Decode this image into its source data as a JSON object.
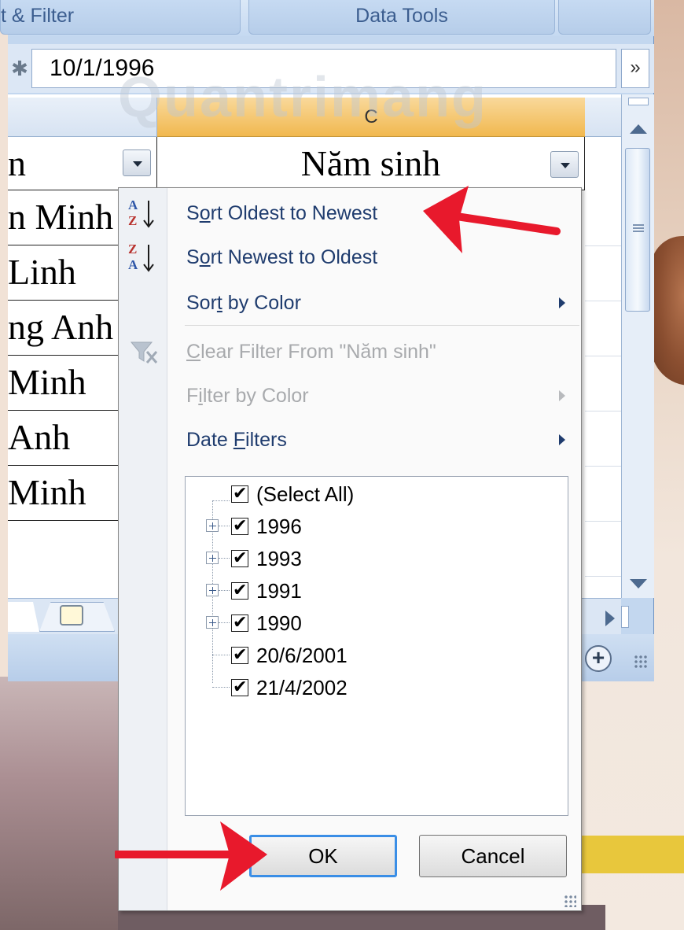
{
  "ribbon": {
    "group_sort_filter": "t & Filter",
    "group_data_tools": "Data Tools"
  },
  "formula_bar": {
    "value": "10/1/1996",
    "expand_icon": "chevron-double-down-icon"
  },
  "grid": {
    "column_header": "C",
    "header_b": "n",
    "header_c": "Năm sinh",
    "rows_b": [
      "n Minh",
      "Linh",
      "ng Anh",
      " Minh",
      "Anh",
      "Minh"
    ]
  },
  "watermark": "Quantrimang",
  "menu": {
    "items": [
      {
        "label_pre": "S",
        "label_ul": "o",
        "label_post": "rt Oldest to Newest",
        "icon": "sort-ascending-icon",
        "enabled": true
      },
      {
        "label_pre": "S",
        "label_ul": "o",
        "label_post": "rt Newest to Oldest",
        "icon": "sort-descending-icon",
        "enabled": true
      },
      {
        "label_pre": "Sor",
        "label_ul": "t",
        "label_post": " by Color",
        "enabled": true,
        "submenu": true
      },
      {
        "label_pre": "",
        "label_ul": "C",
        "label_post": "lear Filter From \"Năm sinh\"",
        "icon": "clear-filter-icon",
        "enabled": false
      },
      {
        "label_pre": "F",
        "label_ul": "i",
        "label_post": "lter by Color",
        "enabled": false,
        "submenu": true
      },
      {
        "label_pre": "Date ",
        "label_ul": "F",
        "label_post": "ilters",
        "enabled": true,
        "submenu": true
      }
    ],
    "checklist": [
      {
        "label": "(Select All)",
        "checked": true,
        "expandable": false
      },
      {
        "label": "1996",
        "checked": true,
        "expandable": true
      },
      {
        "label": "1993",
        "checked": true,
        "expandable": true
      },
      {
        "label": "1991",
        "checked": true,
        "expandable": true
      },
      {
        "label": "1990",
        "checked": true,
        "expandable": true
      },
      {
        "label": "20/6/2001",
        "checked": true,
        "expandable": false
      },
      {
        "label": "21/4/2002",
        "checked": true,
        "expandable": false
      }
    ],
    "ok_label": "OK",
    "cancel_label": "Cancel"
  },
  "colors": {
    "annotation_arrow": "#e8192c",
    "selected_column_header": "#f1b84f",
    "menu_text": "#1f3c6e",
    "ok_focus_border": "#3a8ee6"
  }
}
